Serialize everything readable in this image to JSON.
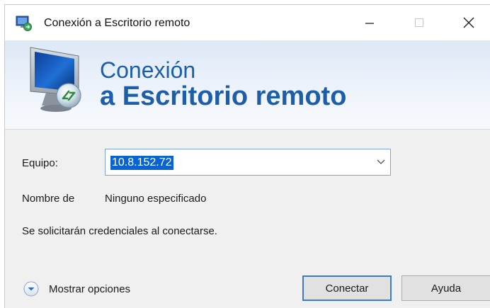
{
  "window": {
    "title": "Conexión a Escritorio remoto",
    "icon": "remote-desktop-icon"
  },
  "banner": {
    "line1": "Conexión",
    "line2": "a Escritorio remoto",
    "icon": "remote-desktop-monitor-icon"
  },
  "form": {
    "computer_label": "Equipo:",
    "computer_value": "10.8.152.72",
    "username_label": "Nombre de",
    "username_value": "Ninguno especificado",
    "credentials_note": "Se solicitarán credenciales al conectarse."
  },
  "footer": {
    "show_options_label": "Mostrar opciones",
    "connect_label": "Conectar",
    "help_label": "Ayuda"
  },
  "colors": {
    "accent": "#1c5fa8",
    "selection": "#0a64d0",
    "button_focus_border": "#3a7bd0"
  }
}
